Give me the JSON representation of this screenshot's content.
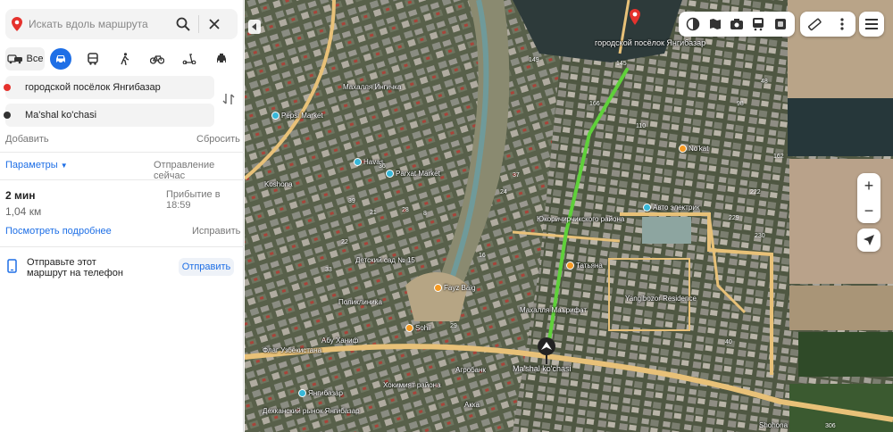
{
  "search": {
    "placeholder": "Искать вдоль маршрута"
  },
  "modes": {
    "all_label": "Все"
  },
  "route": {
    "from": "городской посёлок Янгибазар",
    "to": "Ma'shal ko'chasi",
    "add_label": "Добавить",
    "reset_label": "Сбросить",
    "params_label": "Параметры",
    "depart_label": "Отправление сейчас",
    "duration": "2 мин",
    "arrival": "Прибытие в 18:59",
    "distance": "1,04 км",
    "details_label": "Посмотреть подробнее",
    "fix_label": "Исправить",
    "send_text": "Отправьте этот маршрут на телефон",
    "send_button": "Отправить"
  },
  "map": {
    "place_labels": [
      "городской посёлок Янгибазар",
      "Ma'shal ko'chasi",
      "Махалля Ингичка",
      "Детский сад № 15",
      "Поликлиника",
      "Yangibozor Residence",
      "Махалля Маърифат",
      "Юкоричирчикского района",
      "Хокимият района",
      "Дехканский рынок Янгибазар",
      "Флаг Узбекистана",
      "Агробанк",
      "Акка",
      "Shohona",
      "Koshona",
      "Абу Ханиф"
    ],
    "pois": [
      {
        "name": "Pepsi Market",
        "color": "#38b7d8"
      },
      {
        "name": "Havas",
        "color": "#38b7d8"
      },
      {
        "name": "Parxat Market",
        "color": "#38b7d8"
      },
      {
        "name": "No'kat",
        "color": "#f59a23"
      },
      {
        "name": "Авто электрик",
        "color": "#38b7d8"
      },
      {
        "name": "Татьяна",
        "color": "#f59a23"
      },
      {
        "name": "Fayz Baig",
        "color": "#f59a23"
      },
      {
        "name": "Sohil",
        "color": "#f59a23"
      },
      {
        "name": "Янгибазар",
        "color": "#38b7d8"
      }
    ],
    "house_numbers": [
      "149",
      "145",
      "166",
      "110",
      "162",
      "222",
      "230",
      "229",
      "98",
      "48",
      "24",
      "16",
      "37",
      "36",
      "21",
      "22",
      "39",
      "28",
      "29",
      "306",
      "40",
      "33",
      "8"
    ]
  },
  "colors": {
    "accent": "#1e6fe6",
    "route": "#5fd13a",
    "road": "#e8c178",
    "start_dot": "#e5322d",
    "end_dot": "#333333"
  },
  "icons": [
    "map-pin-icon",
    "search-icon",
    "close-icon",
    "car-icon",
    "bus-icon",
    "walk-icon",
    "bike-icon",
    "scooter-icon",
    "taxi-icon",
    "swap-icon",
    "phone-icon",
    "layers-icon",
    "ruler-icon",
    "more-icon",
    "menu-icon",
    "locate-icon"
  ]
}
